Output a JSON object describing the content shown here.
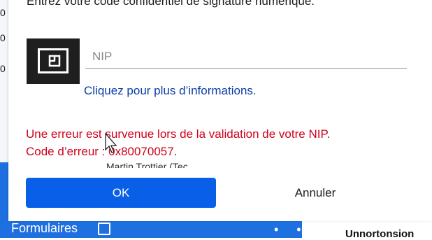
{
  "dialog": {
    "instruction": "Entrez votre code confidentiel de signature numérique.",
    "pin_placeholder": "NIP",
    "info_link": "Cliquez pour plus d’informations.",
    "error_line1": "Une erreur est survenue lors de la validation de votre NIP.",
    "error_line2": "Code d’erreur : 0x80070057.",
    "ok_label": "OK",
    "cancel_label": "Annuler",
    "accent_color": "#0a5fe8",
    "error_color": "#d0021b",
    "card_icon": "smart-card-icon"
  },
  "background": {
    "bleed_text": "Martin Trottier (Tec",
    "taskbar_label": "Formulaires",
    "right_text": "Unnortonsion"
  }
}
